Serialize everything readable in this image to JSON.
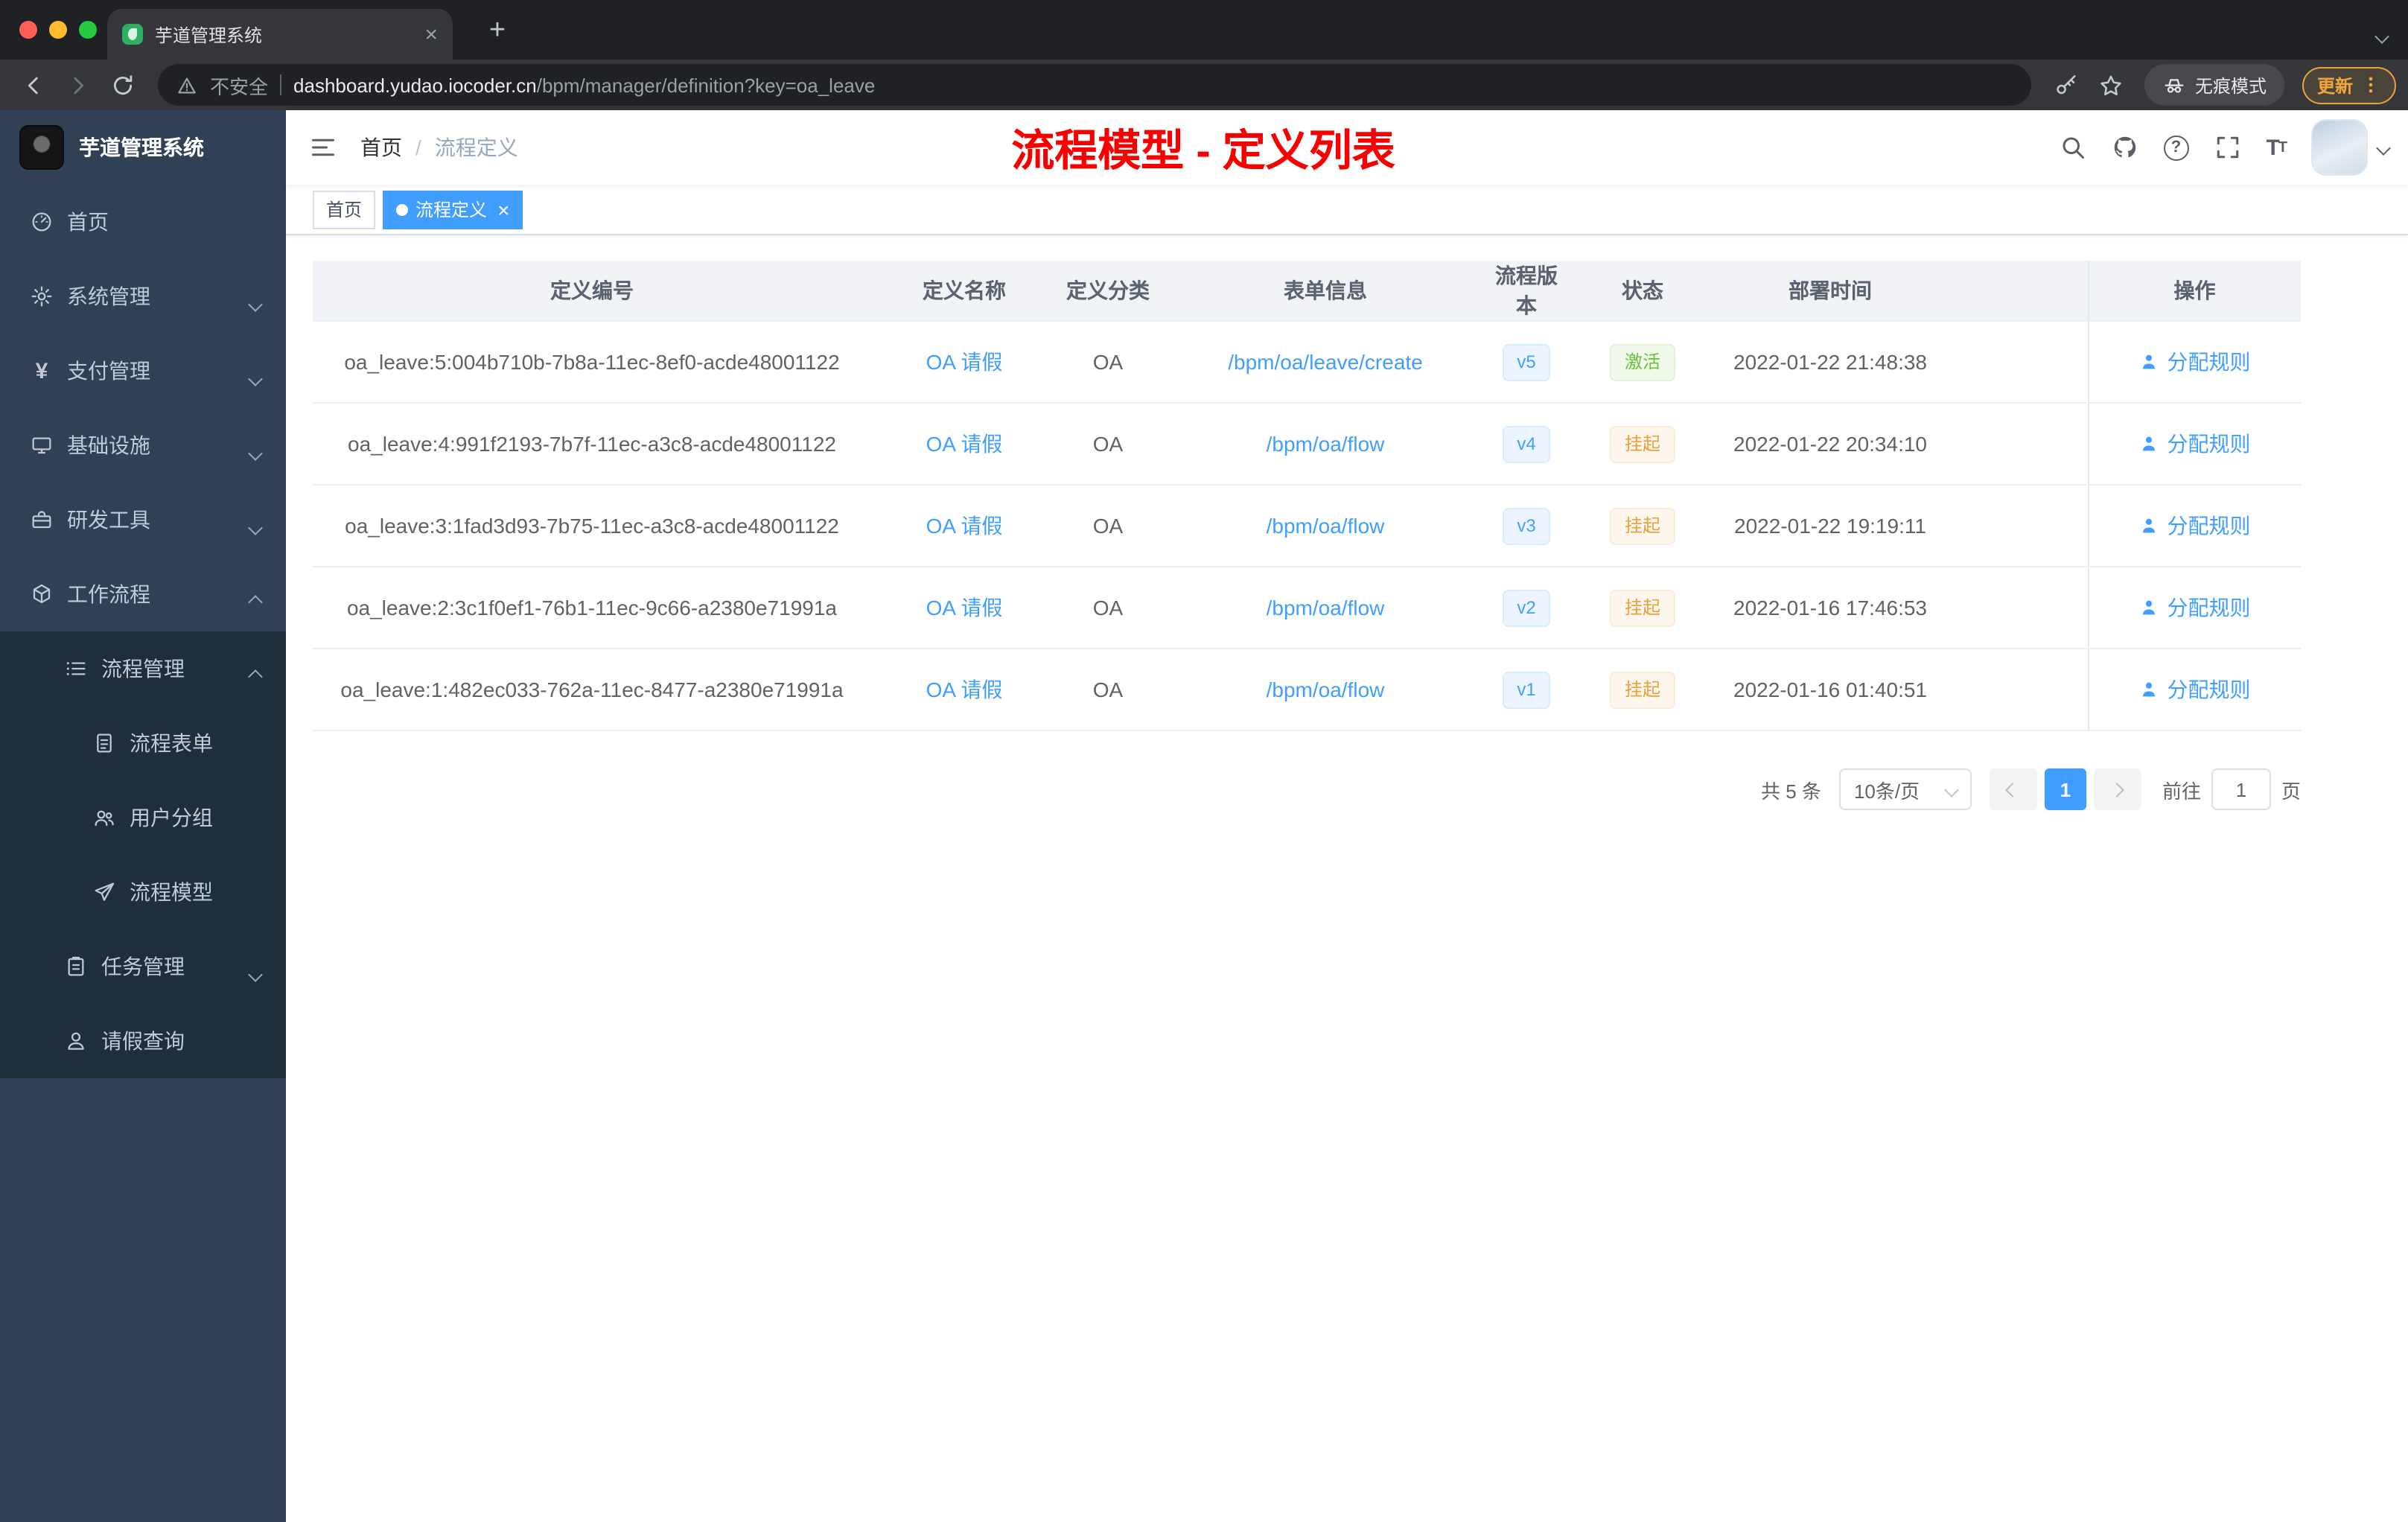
{
  "colors": {
    "accent": "#409EFF",
    "success": "#67C23A",
    "warning": "#E6A23C",
    "annotation_red": "#F80000",
    "sidebar_bg": "#304156",
    "submenu_bg": "#1F2D3D"
  },
  "browser": {
    "tab_title": "芋道管理系统",
    "security_label": "不安全",
    "url_domain": "dashboard.yudao.iocoder.cn",
    "url_path": "/bpm/manager/definition?key=oa_leave",
    "incognito_label": "无痕模式",
    "update_label": "更新"
  },
  "sidebar": {
    "logo_title": "芋道管理系统",
    "items": [
      {
        "label": "首页"
      },
      {
        "label": "系统管理"
      },
      {
        "label": "支付管理"
      },
      {
        "label": "基础设施"
      },
      {
        "label": "研发工具"
      },
      {
        "label": "工作流程"
      },
      {
        "label": "流程管理"
      },
      {
        "label": "流程表单"
      },
      {
        "label": "用户分组"
      },
      {
        "label": "流程模型"
      },
      {
        "label": "任务管理"
      },
      {
        "label": "请假查询"
      }
    ]
  },
  "header": {
    "breadcrumb_home": "首页",
    "breadcrumb_current": "流程定义",
    "annotation": "流程模型 - 定义列表"
  },
  "tags": [
    {
      "label": "首页"
    },
    {
      "label": "流程定义"
    }
  ],
  "table": {
    "columns": [
      "定义编号",
      "定义名称",
      "定义分类",
      "表单信息",
      "流程版本",
      "状态",
      "部署时间",
      "操作"
    ],
    "rows": [
      {
        "id": "oa_leave:5:004b710b-7b8a-11ec-8ef0-acde48001122",
        "name": "OA 请假",
        "category": "OA",
        "form": "/bpm/oa/leave/create",
        "version": "v5",
        "status": "激活",
        "deploy_time": "2022-01-22 21:48:38",
        "action": "分配规则"
      },
      {
        "id": "oa_leave:4:991f2193-7b7f-11ec-a3c8-acde48001122",
        "name": "OA 请假",
        "category": "OA",
        "form": "/bpm/oa/flow",
        "version": "v4",
        "status": "挂起",
        "deploy_time": "2022-01-22 20:34:10",
        "action": "分配规则"
      },
      {
        "id": "oa_leave:3:1fad3d93-7b75-11ec-a3c8-acde48001122",
        "name": "OA 请假",
        "category": "OA",
        "form": "/bpm/oa/flow",
        "version": "v3",
        "status": "挂起",
        "deploy_time": "2022-01-22 19:19:11",
        "action": "分配规则"
      },
      {
        "id": "oa_leave:2:3c1f0ef1-76b1-11ec-9c66-a2380e71991a",
        "name": "OA 请假",
        "category": "OA",
        "form": "/bpm/oa/flow",
        "version": "v2",
        "status": "挂起",
        "deploy_time": "2022-01-16 17:46:53",
        "action": "分配规则"
      },
      {
        "id": "oa_leave:1:482ec033-762a-11ec-8477-a2380e71991a",
        "name": "OA 请假",
        "category": "OA",
        "form": "/bpm/oa/flow",
        "version": "v1",
        "status": "挂起",
        "deploy_time": "2022-01-16 01:40:51",
        "action": "分配规则"
      }
    ]
  },
  "pagination": {
    "total": "共 5 条",
    "page_size": "10条/页",
    "current_page": "1",
    "goto_label": "前往",
    "goto_value": "1",
    "page_unit": "页"
  }
}
